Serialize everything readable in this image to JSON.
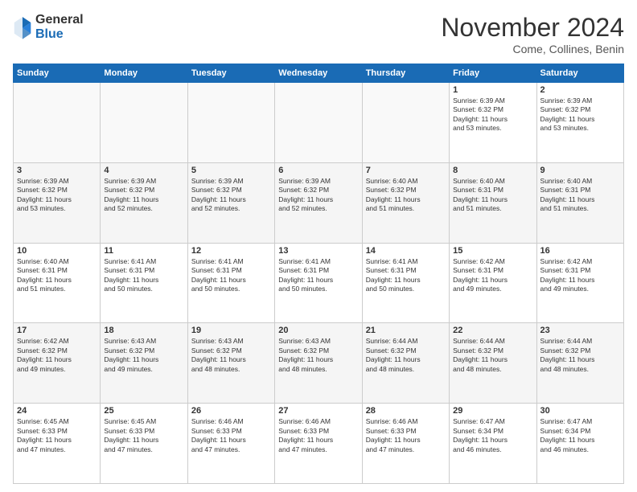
{
  "logo": {
    "general": "General",
    "blue": "Blue"
  },
  "title": "November 2024",
  "location": "Come, Collines, Benin",
  "days_header": [
    "Sunday",
    "Monday",
    "Tuesday",
    "Wednesday",
    "Thursday",
    "Friday",
    "Saturday"
  ],
  "weeks": [
    {
      "alt": false,
      "days": [
        {
          "num": "",
          "info": ""
        },
        {
          "num": "",
          "info": ""
        },
        {
          "num": "",
          "info": ""
        },
        {
          "num": "",
          "info": ""
        },
        {
          "num": "",
          "info": ""
        },
        {
          "num": "1",
          "info": "Sunrise: 6:39 AM\nSunset: 6:32 PM\nDaylight: 11 hours\nand 53 minutes."
        },
        {
          "num": "2",
          "info": "Sunrise: 6:39 AM\nSunset: 6:32 PM\nDaylight: 11 hours\nand 53 minutes."
        }
      ]
    },
    {
      "alt": true,
      "days": [
        {
          "num": "3",
          "info": "Sunrise: 6:39 AM\nSunset: 6:32 PM\nDaylight: 11 hours\nand 53 minutes."
        },
        {
          "num": "4",
          "info": "Sunrise: 6:39 AM\nSunset: 6:32 PM\nDaylight: 11 hours\nand 52 minutes."
        },
        {
          "num": "5",
          "info": "Sunrise: 6:39 AM\nSunset: 6:32 PM\nDaylight: 11 hours\nand 52 minutes."
        },
        {
          "num": "6",
          "info": "Sunrise: 6:39 AM\nSunset: 6:32 PM\nDaylight: 11 hours\nand 52 minutes."
        },
        {
          "num": "7",
          "info": "Sunrise: 6:40 AM\nSunset: 6:32 PM\nDaylight: 11 hours\nand 51 minutes."
        },
        {
          "num": "8",
          "info": "Sunrise: 6:40 AM\nSunset: 6:31 PM\nDaylight: 11 hours\nand 51 minutes."
        },
        {
          "num": "9",
          "info": "Sunrise: 6:40 AM\nSunset: 6:31 PM\nDaylight: 11 hours\nand 51 minutes."
        }
      ]
    },
    {
      "alt": false,
      "days": [
        {
          "num": "10",
          "info": "Sunrise: 6:40 AM\nSunset: 6:31 PM\nDaylight: 11 hours\nand 51 minutes."
        },
        {
          "num": "11",
          "info": "Sunrise: 6:41 AM\nSunset: 6:31 PM\nDaylight: 11 hours\nand 50 minutes."
        },
        {
          "num": "12",
          "info": "Sunrise: 6:41 AM\nSunset: 6:31 PM\nDaylight: 11 hours\nand 50 minutes."
        },
        {
          "num": "13",
          "info": "Sunrise: 6:41 AM\nSunset: 6:31 PM\nDaylight: 11 hours\nand 50 minutes."
        },
        {
          "num": "14",
          "info": "Sunrise: 6:41 AM\nSunset: 6:31 PM\nDaylight: 11 hours\nand 50 minutes."
        },
        {
          "num": "15",
          "info": "Sunrise: 6:42 AM\nSunset: 6:31 PM\nDaylight: 11 hours\nand 49 minutes."
        },
        {
          "num": "16",
          "info": "Sunrise: 6:42 AM\nSunset: 6:31 PM\nDaylight: 11 hours\nand 49 minutes."
        }
      ]
    },
    {
      "alt": true,
      "days": [
        {
          "num": "17",
          "info": "Sunrise: 6:42 AM\nSunset: 6:32 PM\nDaylight: 11 hours\nand 49 minutes."
        },
        {
          "num": "18",
          "info": "Sunrise: 6:43 AM\nSunset: 6:32 PM\nDaylight: 11 hours\nand 49 minutes."
        },
        {
          "num": "19",
          "info": "Sunrise: 6:43 AM\nSunset: 6:32 PM\nDaylight: 11 hours\nand 48 minutes."
        },
        {
          "num": "20",
          "info": "Sunrise: 6:43 AM\nSunset: 6:32 PM\nDaylight: 11 hours\nand 48 minutes."
        },
        {
          "num": "21",
          "info": "Sunrise: 6:44 AM\nSunset: 6:32 PM\nDaylight: 11 hours\nand 48 minutes."
        },
        {
          "num": "22",
          "info": "Sunrise: 6:44 AM\nSunset: 6:32 PM\nDaylight: 11 hours\nand 48 minutes."
        },
        {
          "num": "23",
          "info": "Sunrise: 6:44 AM\nSunset: 6:32 PM\nDaylight: 11 hours\nand 48 minutes."
        }
      ]
    },
    {
      "alt": false,
      "days": [
        {
          "num": "24",
          "info": "Sunrise: 6:45 AM\nSunset: 6:33 PM\nDaylight: 11 hours\nand 47 minutes."
        },
        {
          "num": "25",
          "info": "Sunrise: 6:45 AM\nSunset: 6:33 PM\nDaylight: 11 hours\nand 47 minutes."
        },
        {
          "num": "26",
          "info": "Sunrise: 6:46 AM\nSunset: 6:33 PM\nDaylight: 11 hours\nand 47 minutes."
        },
        {
          "num": "27",
          "info": "Sunrise: 6:46 AM\nSunset: 6:33 PM\nDaylight: 11 hours\nand 47 minutes."
        },
        {
          "num": "28",
          "info": "Sunrise: 6:46 AM\nSunset: 6:33 PM\nDaylight: 11 hours\nand 47 minutes."
        },
        {
          "num": "29",
          "info": "Sunrise: 6:47 AM\nSunset: 6:34 PM\nDaylight: 11 hours\nand 46 minutes."
        },
        {
          "num": "30",
          "info": "Sunrise: 6:47 AM\nSunset: 6:34 PM\nDaylight: 11 hours\nand 46 minutes."
        }
      ]
    }
  ]
}
